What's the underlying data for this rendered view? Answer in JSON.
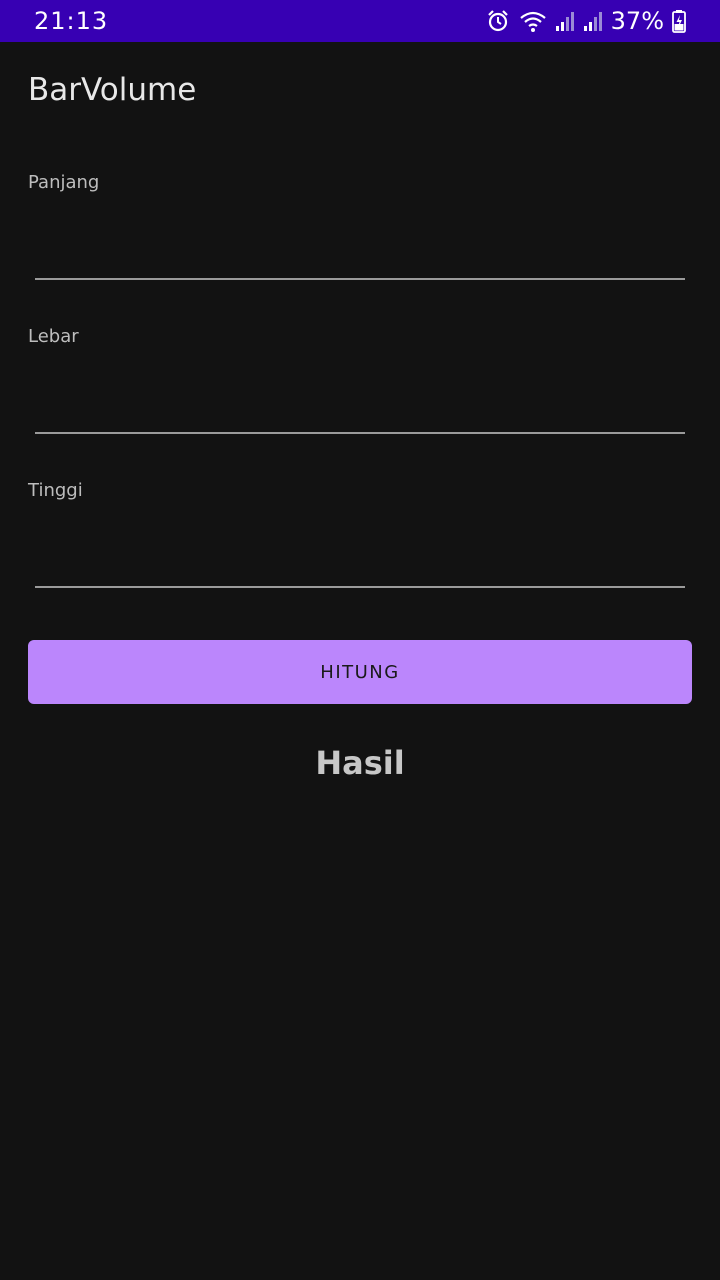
{
  "status_bar": {
    "time": "21:13",
    "battery": "37%",
    "icons": [
      "alarm-icon",
      "wifi-icon",
      "signal-icon",
      "signal-icon",
      "battery-charging-icon"
    ]
  },
  "app": {
    "title": "BarVolume"
  },
  "form": {
    "fields": [
      {
        "label": "Panjang",
        "value": ""
      },
      {
        "label": "Lebar",
        "value": ""
      },
      {
        "label": "Tinggi",
        "value": ""
      }
    ],
    "button_label": "HITUNG",
    "result": "Hasil"
  },
  "colors": {
    "status_bar": "#3700b3",
    "background": "#121212",
    "accent": "#bb86fc"
  }
}
